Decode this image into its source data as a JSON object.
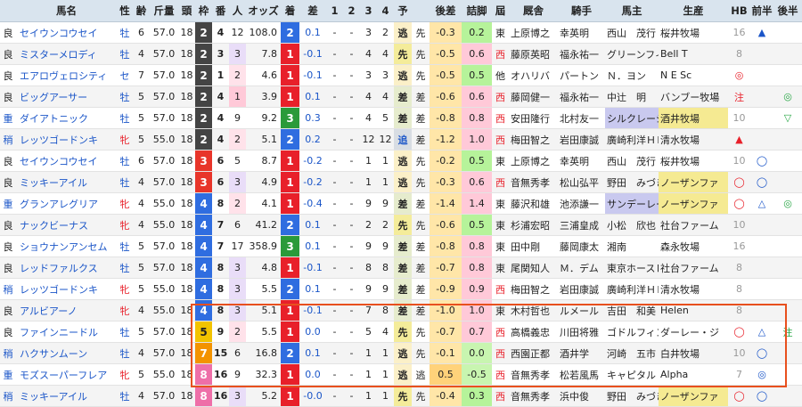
{
  "headers": [
    "",
    "馬名",
    "性",
    "齢",
    "斤量",
    "頭",
    "枠",
    "番",
    "人",
    "オッズ",
    "着",
    "差",
    "1",
    "2",
    "3",
    "4",
    "予",
    "",
    "後差",
    "詰脚",
    "屆",
    "厩舎",
    "騎手",
    "馬主",
    "生産",
    "HB",
    "前半",
    "後半"
  ],
  "colors": {
    "waku": {
      "1": "#ffffff",
      "2": "#444444",
      "3": "#e8352a",
      "4": "#2f6de0",
      "5": "#f2c300",
      "6": "#28a745",
      "7": "#f39300",
      "8": "#ee6fa8"
    },
    "chaku": {
      "1": "#e8202a",
      "2": "#2f6de0",
      "3": "#2a9a3a"
    },
    "yo_nige": "#fbf0c8",
    "yo_sen": "#f4ec9a",
    "yo_sashi": "#e6eccd",
    "yo_oikomi": "#d8dde3",
    "kosa_bg": "#ffe6a8",
    "tsume_bg": "#b6f39a",
    "tsume_red": "#ffc9d8",
    "box": "#e8501e"
  },
  "rows": [
    {
      "baba": "良",
      "name": "セイウンコウセイ",
      "sex": "牡",
      "age": "6",
      "kin": "57.0",
      "tou": "18",
      "waku": "2",
      "ban": "4",
      "nin": "12",
      "odds": "108.0",
      "chaku": "2",
      "sa": "0.1",
      "c1": "-",
      "c2": "-",
      "c3": "3",
      "c4": "2",
      "yo": "逃",
      "pos": "先",
      "kosa": "-0.3",
      "tsume": "0.2",
      "zoku": "東",
      "kyu": "上原博之",
      "kishu": "幸英明",
      "banushi": "西山　茂行",
      "seisan": "桜井牧場",
      "hb": "16",
      "zen": "▲",
      "kou": ""
    },
    {
      "baba": "良",
      "name": "ミスターメロディ",
      "sex": "牡",
      "age": "4",
      "kin": "57.0",
      "tou": "18",
      "waku": "2",
      "ban": "3",
      "nin": "3",
      "odds": "7.8",
      "chaku": "1",
      "sa": "-0.1",
      "c1": "-",
      "c2": "-",
      "c3": "4",
      "c4": "4",
      "yo": "先",
      "pos": "先",
      "kosa": "-0.5",
      "tsume": "0.6",
      "zoku": "西",
      "kyu": "藤原英昭",
      "kishu": "福永祐一",
      "banushi": "グリーンフィ",
      "seisan": "Bell T",
      "hb": "8",
      "zen": "",
      "kou": ""
    },
    {
      "baba": "良",
      "name": "エアロヴェロシティ",
      "sex": "セ",
      "age": "7",
      "kin": "57.0",
      "tou": "18",
      "waku": "2",
      "ban": "1",
      "nin": "2",
      "odds": "4.6",
      "chaku": "1",
      "sa": "-0.1",
      "c1": "-",
      "c2": "-",
      "c3": "3",
      "c4": "3",
      "yo": "逃",
      "pos": "先",
      "kosa": "-0.5",
      "tsume": "0.5",
      "zoku": "他",
      "kyu": "オハリバ",
      "kishu": "パートン",
      "banushi": "Ｎ．ヨン",
      "seisan": "N E Sc",
      "hb": "◎",
      "zen": "",
      "kou": ""
    },
    {
      "baba": "良",
      "name": "ビッグアーサー",
      "sex": "牡",
      "age": "5",
      "kin": "57.0",
      "tou": "18",
      "waku": "2",
      "ban": "4",
      "nin": "1",
      "odds": "3.9",
      "chaku": "1",
      "sa": "0.1",
      "c1": "-",
      "c2": "-",
      "c3": "4",
      "c4": "4",
      "yo": "差",
      "pos": "差",
      "kosa": "-0.6",
      "tsume": "0.6",
      "zoku": "西",
      "kyu": "藤岡健一",
      "kishu": "福永祐一",
      "banushi": "中辻　明",
      "seisan": "バンブー牧場",
      "hb": "注",
      "zen": "",
      "kou": "◎"
    },
    {
      "baba": "重",
      "name": "ダイアトニック",
      "sex": "牡",
      "age": "5",
      "kin": "57.0",
      "tou": "18",
      "waku": "2",
      "ban": "4",
      "nin": "9",
      "odds": "9.2",
      "chaku": "3",
      "sa": "0.3",
      "c1": "-",
      "c2": "-",
      "c3": "4",
      "c4": "5",
      "yo": "差",
      "pos": "差",
      "kosa": "-0.8",
      "tsume": "0.8",
      "zoku": "西",
      "kyu": "安田隆行",
      "kishu": "北村友一",
      "banushi": "シルクレーシ",
      "seisan": "酒井牧場",
      "hb": "10",
      "zen": "",
      "kou": "▽"
    },
    {
      "baba": "稍",
      "name": "レッツゴードンキ",
      "sex": "牝",
      "age": "5",
      "kin": "55.0",
      "tou": "18",
      "waku": "2",
      "ban": "4",
      "nin": "2",
      "odds": "5.1",
      "chaku": "2",
      "sa": "0.2",
      "c1": "-",
      "c2": "-",
      "c3": "12",
      "c4": "12",
      "yo": "追",
      "pos": "差",
      "kosa": "-1.2",
      "tsume": "1.0",
      "zoku": "西",
      "kyu": "梅田智之",
      "kishu": "岩田康誠",
      "banushi": "廣崎利洋ＨＤ",
      "seisan": "清水牧場",
      "hb": "▲",
      "zen": "",
      "kou": ""
    },
    {
      "baba": "良",
      "name": "セイウンコウセイ",
      "sex": "牡",
      "age": "6",
      "kin": "57.0",
      "tou": "18",
      "waku": "3",
      "ban": "6",
      "nin": "5",
      "odds": "8.7",
      "chaku": "1",
      "sa": "-0.2",
      "c1": "-",
      "c2": "-",
      "c3": "1",
      "c4": "1",
      "yo": "逃",
      "pos": "先",
      "kosa": "-0.2",
      "tsume": "0.5",
      "zoku": "東",
      "kyu": "上原博之",
      "kishu": "幸英明",
      "banushi": "西山　茂行",
      "seisan": "桜井牧場",
      "hb": "10",
      "zen": "◯",
      "kou": ""
    },
    {
      "baba": "良",
      "name": "ミッキーアイル",
      "sex": "牡",
      "age": "4",
      "kin": "57.0",
      "tou": "18",
      "waku": "3",
      "ban": "6",
      "nin": "3",
      "odds": "4.9",
      "chaku": "1",
      "sa": "-0.2",
      "c1": "-",
      "c2": "-",
      "c3": "1",
      "c4": "1",
      "yo": "逃",
      "pos": "先",
      "kosa": "-0.3",
      "tsume": "0.6",
      "zoku": "西",
      "kyu": "音無秀孝",
      "kishu": "松山弘平",
      "banushi": "野田　みづき",
      "seisan": "ノーザンファ",
      "hb": "◯",
      "zen": "◯",
      "kou": ""
    },
    {
      "baba": "重",
      "name": "グランアレグリア",
      "sex": "牝",
      "age": "4",
      "kin": "55.0",
      "tou": "18",
      "waku": "4",
      "ban": "8",
      "nin": "2",
      "odds": "4.1",
      "chaku": "1",
      "sa": "-0.4",
      "c1": "-",
      "c2": "-",
      "c3": "9",
      "c4": "9",
      "yo": "差",
      "pos": "差",
      "kosa": "-1.4",
      "tsume": "1.4",
      "zoku": "東",
      "kyu": "藤沢和雄",
      "kishu": "池添謙一",
      "banushi": "サンデーレー",
      "seisan": "ノーザンファ",
      "hb": "◯",
      "zen": "△",
      "kou": "◎"
    },
    {
      "baba": "良",
      "name": "ナックビーナス",
      "sex": "牝",
      "age": "4",
      "kin": "55.0",
      "tou": "18",
      "waku": "4",
      "ban": "7",
      "nin": "6",
      "odds": "41.2",
      "chaku": "2",
      "sa": "0.1",
      "c1": "-",
      "c2": "-",
      "c3": "2",
      "c4": "2",
      "yo": "先",
      "pos": "先",
      "kosa": "-0.6",
      "tsume": "0.5",
      "zoku": "東",
      "kyu": "杉浦宏昭",
      "kishu": "三浦皇成",
      "banushi": "小松　欣也",
      "seisan": "社台ファーム",
      "hb": "10",
      "zen": "",
      "kou": ""
    },
    {
      "baba": "良",
      "name": "ショウナンアンセム",
      "sex": "牡",
      "age": "5",
      "kin": "57.0",
      "tou": "18",
      "waku": "4",
      "ban": "7",
      "nin": "17",
      "odds": "358.9",
      "chaku": "3",
      "sa": "0.1",
      "c1": "-",
      "c2": "-",
      "c3": "9",
      "c4": "9",
      "yo": "差",
      "pos": "差",
      "kosa": "-0.8",
      "tsume": "0.8",
      "zoku": "東",
      "kyu": "田中剛",
      "kishu": "藤岡康太",
      "banushi": "湘南",
      "seisan": "森永牧場",
      "hb": "16",
      "zen": "",
      "kou": ""
    },
    {
      "baba": "良",
      "name": "レッドファルクス",
      "sex": "牡",
      "age": "5",
      "kin": "57.0",
      "tou": "18",
      "waku": "4",
      "ban": "8",
      "nin": "3",
      "odds": "4.8",
      "chaku": "1",
      "sa": "-0.1",
      "c1": "-",
      "c2": "-",
      "c3": "8",
      "c4": "8",
      "yo": "差",
      "pos": "差",
      "kosa": "-0.7",
      "tsume": "0.8",
      "zoku": "東",
      "kyu": "尾関知人",
      "kishu": "Ｍ．デム",
      "banushi": "東京ホースレ",
      "seisan": "社台ファーム",
      "hb": "8",
      "zen": "",
      "kou": ""
    },
    {
      "baba": "稍",
      "name": "レッツゴードンキ",
      "sex": "牝",
      "age": "5",
      "kin": "55.0",
      "tou": "18",
      "waku": "4",
      "ban": "8",
      "nin": "3",
      "odds": "5.5",
      "chaku": "2",
      "sa": "0.1",
      "c1": "-",
      "c2": "-",
      "c3": "9",
      "c4": "9",
      "yo": "差",
      "pos": "差",
      "kosa": "-0.9",
      "tsume": "0.9",
      "zoku": "西",
      "kyu": "梅田智之",
      "kishu": "岩田康誠",
      "banushi": "廣崎利洋ＨＤ",
      "seisan": "清水牧場",
      "hb": "8",
      "zen": "",
      "kou": ""
    },
    {
      "baba": "良",
      "name": "アルビアーノ",
      "sex": "牝",
      "age": "4",
      "kin": "55.0",
      "tou": "18",
      "waku": "4",
      "ban": "8",
      "nin": "3",
      "odds": "5.1",
      "chaku": "1",
      "sa": "-0.1",
      "c1": "-",
      "c2": "-",
      "c3": "7",
      "c4": "8",
      "yo": "差",
      "pos": "差",
      "kosa": "-1.0",
      "tsume": "1.0",
      "zoku": "東",
      "kyu": "木村哲也",
      "kishu": "ルメール",
      "banushi": "吉田　和美",
      "seisan": "Helen",
      "hb": "8",
      "zen": "",
      "kou": ""
    },
    {
      "baba": "良",
      "name": "ファインニードル",
      "sex": "牡",
      "age": "5",
      "kin": "57.0",
      "tou": "18",
      "waku": "5",
      "ban": "9",
      "nin": "2",
      "odds": "5.5",
      "chaku": "1",
      "sa": "0.0",
      "c1": "-",
      "c2": "-",
      "c3": "5",
      "c4": "4",
      "yo": "先",
      "pos": "先",
      "kosa": "-0.7",
      "tsume": "0.7",
      "zoku": "西",
      "kyu": "高橋義忠",
      "kishu": "川田将雅",
      "banushi": "ゴドルフィン",
      "seisan": "ダーレー・ジ",
      "hb": "◯",
      "zen": "△",
      "kou": "注"
    },
    {
      "baba": "稍",
      "name": "ハクサンムーン",
      "sex": "牡",
      "age": "4",
      "kin": "57.0",
      "tou": "18",
      "waku": "7",
      "ban": "15",
      "nin": "6",
      "odds": "16.8",
      "chaku": "2",
      "sa": "0.1",
      "c1": "-",
      "c2": "-",
      "c3": "1",
      "c4": "1",
      "yo": "逃",
      "pos": "先",
      "kosa": "-0.1",
      "tsume": "0.0",
      "zoku": "西",
      "kyu": "西園正都",
      "kishu": "酒井学",
      "banushi": "河崎　五市",
      "seisan": "白井牧場",
      "hb": "10",
      "zen": "◯",
      "kou": ""
    },
    {
      "baba": "重",
      "name": "モズスーパーフレア",
      "sex": "牝",
      "age": "5",
      "kin": "55.0",
      "tou": "18",
      "waku": "8",
      "ban": "16",
      "nin": "9",
      "odds": "32.3",
      "chaku": "1",
      "sa": "0.0",
      "c1": "-",
      "c2": "-",
      "c3": "1",
      "c4": "1",
      "yo": "逃",
      "pos": "逃",
      "kosa": "0.5",
      "tsume": "-0.5",
      "zoku": "西",
      "kyu": "音無秀孝",
      "kishu": "松若風馬",
      "banushi": "キャピタル・",
      "seisan": "Alpha",
      "hb": "7",
      "zen": "◎",
      "kou": ""
    },
    {
      "baba": "稍",
      "name": "ミッキーアイル",
      "sex": "牡",
      "age": "4",
      "kin": "57.0",
      "tou": "18",
      "waku": "8",
      "ban": "16",
      "nin": "3",
      "odds": "5.2",
      "chaku": "1",
      "sa": "-0.0",
      "c1": "-",
      "c2": "-",
      "c3": "1",
      "c4": "1",
      "yo": "先",
      "pos": "先",
      "kosa": "-0.4",
      "tsume": "0.3",
      "zoku": "西",
      "kyu": "音無秀孝",
      "kishu": "浜中俊",
      "banushi": "野田　みづき",
      "seisan": "ノーザンファ",
      "hb": "◯",
      "zen": "◯",
      "kou": ""
    }
  ]
}
